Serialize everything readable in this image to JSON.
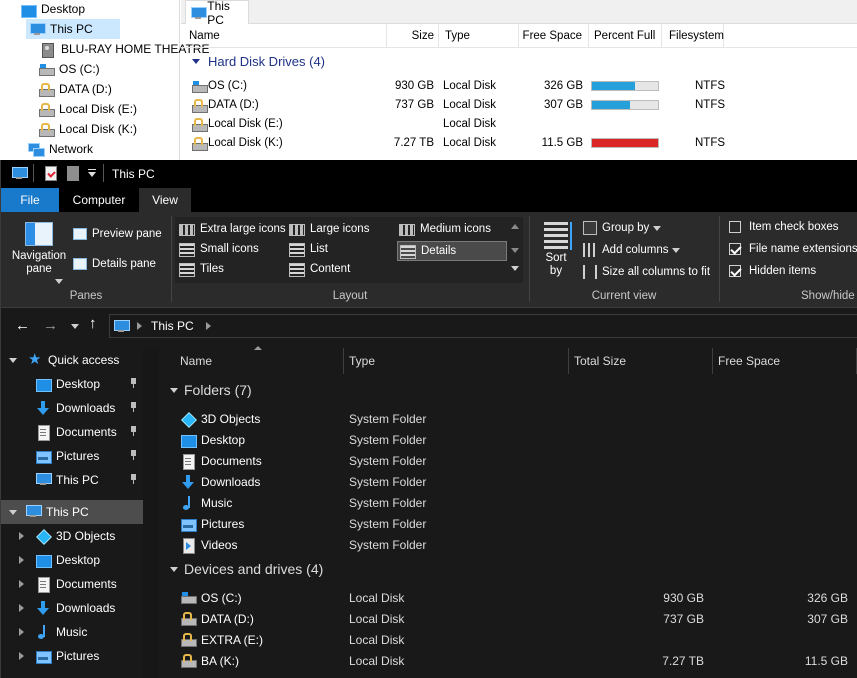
{
  "back_window": {
    "tab_title": "This PC",
    "nav_items": [
      {
        "label": "Desktop",
        "icon": "desktop-icon"
      },
      {
        "label": "This PC",
        "icon": "monitor-icon"
      },
      {
        "label": "BLU-RAY HOME THEATRE",
        "icon": "disc-icon"
      },
      {
        "label": "OS (C:)",
        "icon": "drive-icon"
      },
      {
        "label": "DATA (D:)",
        "icon": "locked-drive-icon"
      },
      {
        "label": "Local Disk (E:)",
        "icon": "locked-drive-icon"
      },
      {
        "label": "Local Disk (K:)",
        "icon": "locked-drive-icon"
      },
      {
        "label": "Network",
        "icon": "network-icon"
      }
    ],
    "columns": [
      "Name",
      "Size",
      "Type",
      "Free Space",
      "Percent Full",
      "Filesystem"
    ],
    "group_label": "Hard Disk Drives (4)",
    "rows": [
      {
        "name": "OS (C:)",
        "size": "930 GB",
        "type": "Local Disk",
        "free": "326 GB",
        "percent_full": 0.65,
        "fs": "NTFS",
        "bar_color": "#26a0da"
      },
      {
        "name": "DATA (D:)",
        "size": "737 GB",
        "type": "Local Disk",
        "free": "307 GB",
        "percent_full": 0.58,
        "fs": "NTFS",
        "bar_color": "#26a0da"
      },
      {
        "name": "Local Disk (E:)",
        "size": "",
        "type": "Local Disk",
        "free": "",
        "percent_full": null,
        "fs": "",
        "bar_color": ""
      },
      {
        "name": "Local Disk (K:)",
        "size": "7.27 TB",
        "type": "Local Disk",
        "free": "11.5 GB",
        "percent_full": 1.0,
        "fs": "NTFS",
        "bar_color": "#da2626"
      }
    ]
  },
  "front_window": {
    "title": "This PC",
    "ribbon_tabs": [
      "File",
      "Computer",
      "View"
    ],
    "panes_group": {
      "label": "Panes",
      "navigation_pane": "Navigation pane",
      "preview_pane": "Preview pane",
      "details_pane": "Details pane"
    },
    "layout_group": {
      "label": "Layout",
      "options": [
        "Extra large icons",
        "Large icons",
        "Medium icons",
        "Small icons",
        "List",
        "Details",
        "Tiles",
        "Content"
      ],
      "selected": "Details"
    },
    "current_view_group": {
      "label": "Current view",
      "sort_by": "Sort by",
      "group_by": "Group by",
      "add_columns": "Add columns",
      "size_columns": "Size all columns to fit"
    },
    "show_hide_group": {
      "label": "Show/hide",
      "item_check_boxes": {
        "label": "Item check boxes",
        "checked": false
      },
      "file_name_extensions": {
        "label": "File name extensions",
        "checked": true
      },
      "hidden_items": {
        "label": "Hidden items",
        "checked": true
      }
    },
    "address": {
      "location": "This PC"
    },
    "nav_pane": [
      {
        "label": "Quick access",
        "icon": "star-icon"
      },
      {
        "label": "Desktop",
        "icon": "desktop-icon",
        "pinned": true
      },
      {
        "label": "Downloads",
        "icon": "downloads-icon",
        "pinned": true
      },
      {
        "label": "Documents",
        "icon": "documents-icon",
        "pinned": true
      },
      {
        "label": "Pictures",
        "icon": "pictures-icon",
        "pinned": true
      },
      {
        "label": "This PC",
        "icon": "monitor-icon",
        "pinned": true
      },
      {
        "label": "This PC",
        "icon": "monitor-icon",
        "selected": true
      },
      {
        "label": "3D Objects",
        "icon": "3d-objects-icon"
      },
      {
        "label": "Desktop",
        "icon": "desktop-icon"
      },
      {
        "label": "Documents",
        "icon": "documents-icon"
      },
      {
        "label": "Downloads",
        "icon": "downloads-icon"
      },
      {
        "label": "Music",
        "icon": "music-icon"
      },
      {
        "label": "Pictures",
        "icon": "pictures-icon"
      }
    ],
    "columns": [
      "Name",
      "Type",
      "Total Size",
      "Free Space"
    ],
    "folders_group": "Folders (7)",
    "folders": [
      {
        "name": "3D Objects",
        "type": "System Folder",
        "icon": "3d-objects-icon"
      },
      {
        "name": "Desktop",
        "type": "System Folder",
        "icon": "desktop-icon"
      },
      {
        "name": "Documents",
        "type": "System Folder",
        "icon": "documents-icon"
      },
      {
        "name": "Downloads",
        "type": "System Folder",
        "icon": "downloads-icon"
      },
      {
        "name": "Music",
        "type": "System Folder",
        "icon": "music-icon"
      },
      {
        "name": "Pictures",
        "type": "System Folder",
        "icon": "pictures-icon"
      },
      {
        "name": "Videos",
        "type": "System Folder",
        "icon": "videos-icon"
      }
    ],
    "drives_group": "Devices and drives (4)",
    "drives": [
      {
        "name": "OS (C:)",
        "type": "Local Disk",
        "total": "930 GB",
        "free": "326 GB",
        "icon": "drive-icon"
      },
      {
        "name": "DATA (D:)",
        "type": "Local Disk",
        "total": "737 GB",
        "free": "307 GB",
        "icon": "locked-drive-icon"
      },
      {
        "name": "EXTRA (E:)",
        "type": "Local Disk",
        "total": "",
        "free": "",
        "icon": "locked-drive-icon"
      },
      {
        "name": "BA (K:)",
        "type": "Local Disk",
        "total": "7.27 TB",
        "free": "11.5 GB",
        "icon": "locked-drive-icon"
      }
    ]
  }
}
